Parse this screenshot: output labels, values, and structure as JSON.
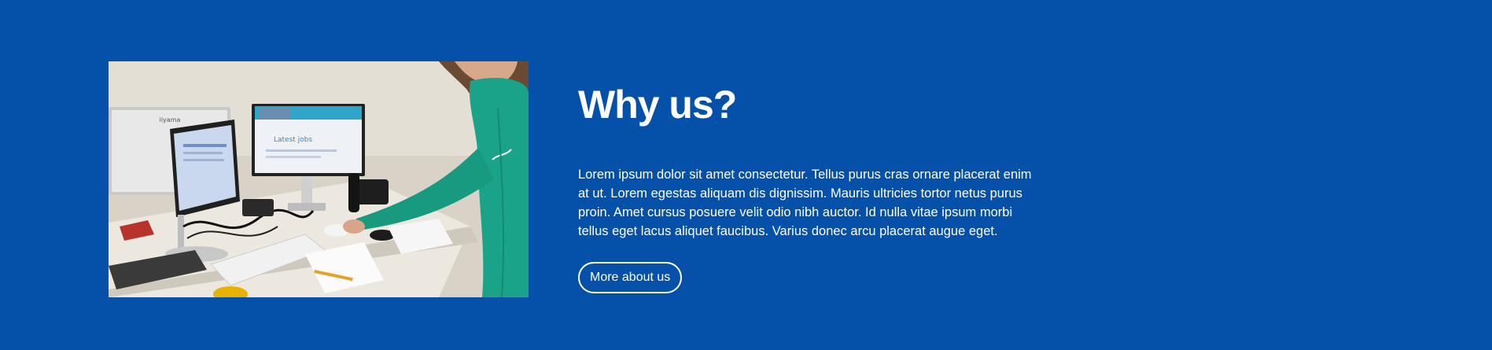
{
  "about": {
    "heading": "Why us?",
    "body": "Lorem ipsum dolor sit amet consectetur. Tellus purus cras ornare placerat enim at ut. Lorem egestas aliquam dis dignissim. Mauris ultricies tortor netus purus proin. Amet cursus posuere velit odio nibh auctor. Id nulla vitae ipsum morbi tellus eget lacus aliquet faucibus. Varius donec arcu placerat augue eget.",
    "button_label": "More about us"
  },
  "photo": {
    "monitor_brand": "iiyama",
    "screen_text": "Latest jobs"
  },
  "colors": {
    "background": "#0550a8",
    "text": "#ffffff",
    "hoodie": "#1aa388"
  }
}
